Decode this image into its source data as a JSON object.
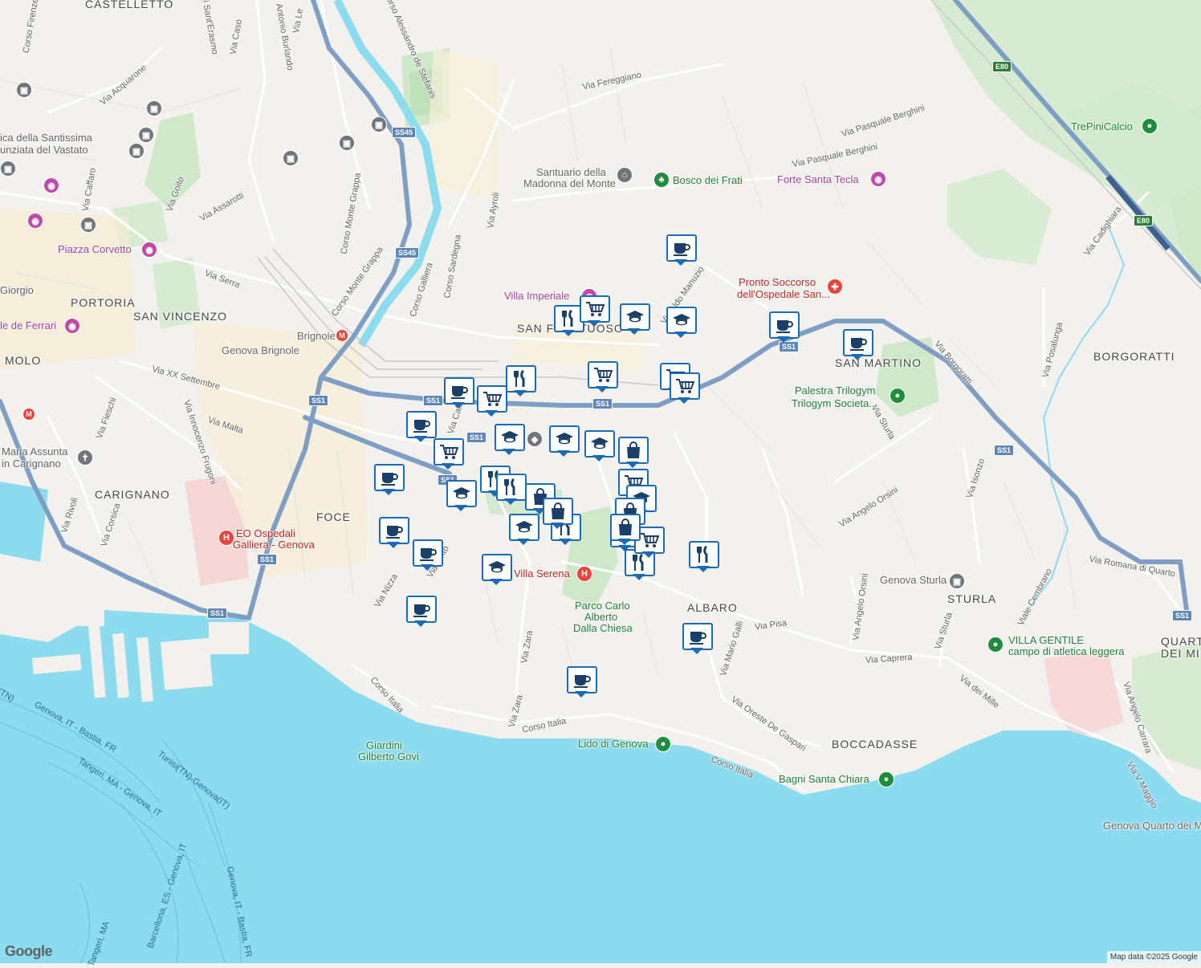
{
  "map": {
    "copyright": "Map data ©2025 Google",
    "logo": "Google",
    "colors": {
      "land": "#f3f1ee",
      "water": "#8ddbef",
      "park": "#cfe8c9",
      "road": "#ffffff",
      "highway": "#7f9ec4",
      "marker_border": "#1b6ab3"
    }
  },
  "districts": {
    "castelletto": "CASTELLETTO",
    "portoria": "PORTORIA",
    "san_vincenzo": "SAN VINCENZO",
    "molo": "MOLO",
    "carignano": "CARIGNANO",
    "foce": "FOCE",
    "san_fruttuoso": "SAN FRUTTUOSO",
    "san_martino": "SAN MARTINO",
    "borgoratti": "BORGORATTI",
    "albaro": "ALBARO",
    "sturla": "STURLA",
    "boccadasse": "BOCCADASSE",
    "quarto_1": "QUART",
    "quarto_2": "DEI MIL"
  },
  "streets": {
    "corso_firenze": "Corso Firenze",
    "via_sant_erasmo": "di Sant'Erasmo",
    "via_caso": "Via Caso",
    "antonio_burlando": "Antonio Burlando",
    "via_lei": "Via Le",
    "corso_de_stefanis": "Corso Alessandro de Stefanis",
    "via_acquarone": "Via Acquarone",
    "via_caffaro": "Via Caffaro",
    "via_goito": "Via Goito",
    "via_assarotti": "Via Assarotti",
    "corso_monte_grappa": "Corso Monte Grappa",
    "corso_monte_grappa_2": "Corso Monte Grappa",
    "via_serra": "Via Serra",
    "corso_galliera": "Corso Galliera",
    "corso_sardegna": "Corso Sardegna",
    "via_ayroli": "Via Ayroli",
    "via_fereggiano": "Via Fereggiano",
    "via_berghini_1": "Via Pasquale Berghini",
    "via_berghini_2": "Via Pasquale Berghini",
    "via_manuzio": "Via Aldo Manuzio",
    "via_xx_settembre": "Via XX Settembre",
    "via_fieschi": "Via Fieschi",
    "via_frugoni": "Via Innocenzo Frugoni",
    "via_malta": "Via Malta",
    "via_rivoli": "Via Rivoli",
    "via_corsica": "Via Corsica",
    "via_nizza": "Via Nizza",
    "via_pisa": "Via Pisa",
    "via_zara_1": "Via Zara",
    "via_zara_2": "Via Zara",
    "corso_italia_1": "Corso Italia",
    "corso_italia_2": "Corso Italia",
    "corso_italia_3": "Corso Italia",
    "via_mario_galli": "Via Mario Galli",
    "via_oreste_de_gaspari": "Via Oreste De Gaspari",
    "via_caprera": "Via Caprera",
    "via_dei_mille": "Via dei Mille",
    "via_angelo_orsini_1": "Via Angelo Orsini",
    "via_angelo_orsini_2": "Via Angelo Orsini",
    "via_sturla_1": "Via Sturla",
    "via_sturla_2": "Via Sturla",
    "via_isonzo": "Via Isonzo",
    "via_borgoratti": "Via Borgoratti",
    "via_posalunga": "Via Posalunga",
    "via_cadighiara": "Via Cadighiara",
    "viale_cembrano": "Viale Cembrano",
    "via_romana_quarto": "Via Romana di Quarto",
    "via_angelo_carrara": "Via Angelo Carrara",
    "via_v_maggio": "Via V Maggio",
    "via_caff": "Via Caff",
    "via_pinto": "Via Pinto"
  },
  "sea_routes": {
    "r1": "Genova, IT - Bastia, FR",
    "r2": "Tangeri, MA - Genova, IT",
    "r3": "Tunisi(TN)-Genova(IT)",
    "r4": "Barcellona, ES - Genova, IT",
    "r5": "Genova, IT - Bastia, FR",
    "r6": "Tangeri, MA",
    "r7": "(TN)"
  },
  "shields": {
    "ss45_1": "SS45",
    "ss45_2": "SS45",
    "ss1_1": "SS1",
    "ss1_2": "SS1",
    "ss1_3": "SS1",
    "ss1_4": "SS1",
    "ss1_5": "SS1",
    "ss1_6": "SS1",
    "ss1_7": "SS1",
    "ss1_8": "SS1",
    "ss1_9": "SS1",
    "e80_1": "E80",
    "e80_2": "E80"
  },
  "places": {
    "santissima_1": "ica della Santissima",
    "santissima_2": "unziata del Vastato",
    "piazza_corvetto": "Piazza Corvetto",
    "giorgio": "Giorgio",
    "de_ferrari": "le de Ferrari",
    "brignole_station": "Brignole",
    "genova_brignole": "Genova Brignole",
    "villa_imperiale": "Villa Imperiale",
    "santuario_1": "Santuario della",
    "santuario_2": "Madonna del Monte",
    "bosco_dei_frati": "Bosco dei Frati",
    "forte_santa_tecla": "Forte Santa Tecla",
    "pronto_soccorso_1": "Pronto Soccorso",
    "pronto_soccorso_2": "dell'Ospedale San...",
    "trepini": "TrePiniCalcio",
    "palestra_1": "Palestra Trilogym",
    "palestra_2": "Trilogym Societa...",
    "maria_assunta_1": "Maria Assunta",
    "maria_assunta_2": "in Carignano",
    "ospedali_galliera_1": "EO Ospedali",
    "ospedali_galliera_2": "Galliera - Genova",
    "villa_serena": "Villa Serena",
    "parco_1": "Parco Carlo",
    "parco_2": "Alberto",
    "parco_3": "Dalla Chiesa",
    "genova_sturla": "Genova Sturla",
    "villa_gentile_1": "VILLA GENTILE",
    "villa_gentile_2": "campo di atletica leggera",
    "giardini_1": "Giardini",
    "giardini_2": "Gilberto Govi",
    "lido": "Lido di Genova",
    "bagni_santa_chiara": "Bagni Santa Chiara",
    "quarto_station": "Genova Quarto dei M"
  },
  "markers": [
    {
      "icon": "cafe",
      "name": "cafe-marker"
    },
    {
      "icon": "restaurant",
      "name": "restaurant-marker"
    },
    {
      "icon": "grocery",
      "name": "grocery-marker"
    },
    {
      "icon": "school",
      "name": "school-marker"
    },
    {
      "icon": "shopping",
      "name": "shopping-marker"
    }
  ]
}
